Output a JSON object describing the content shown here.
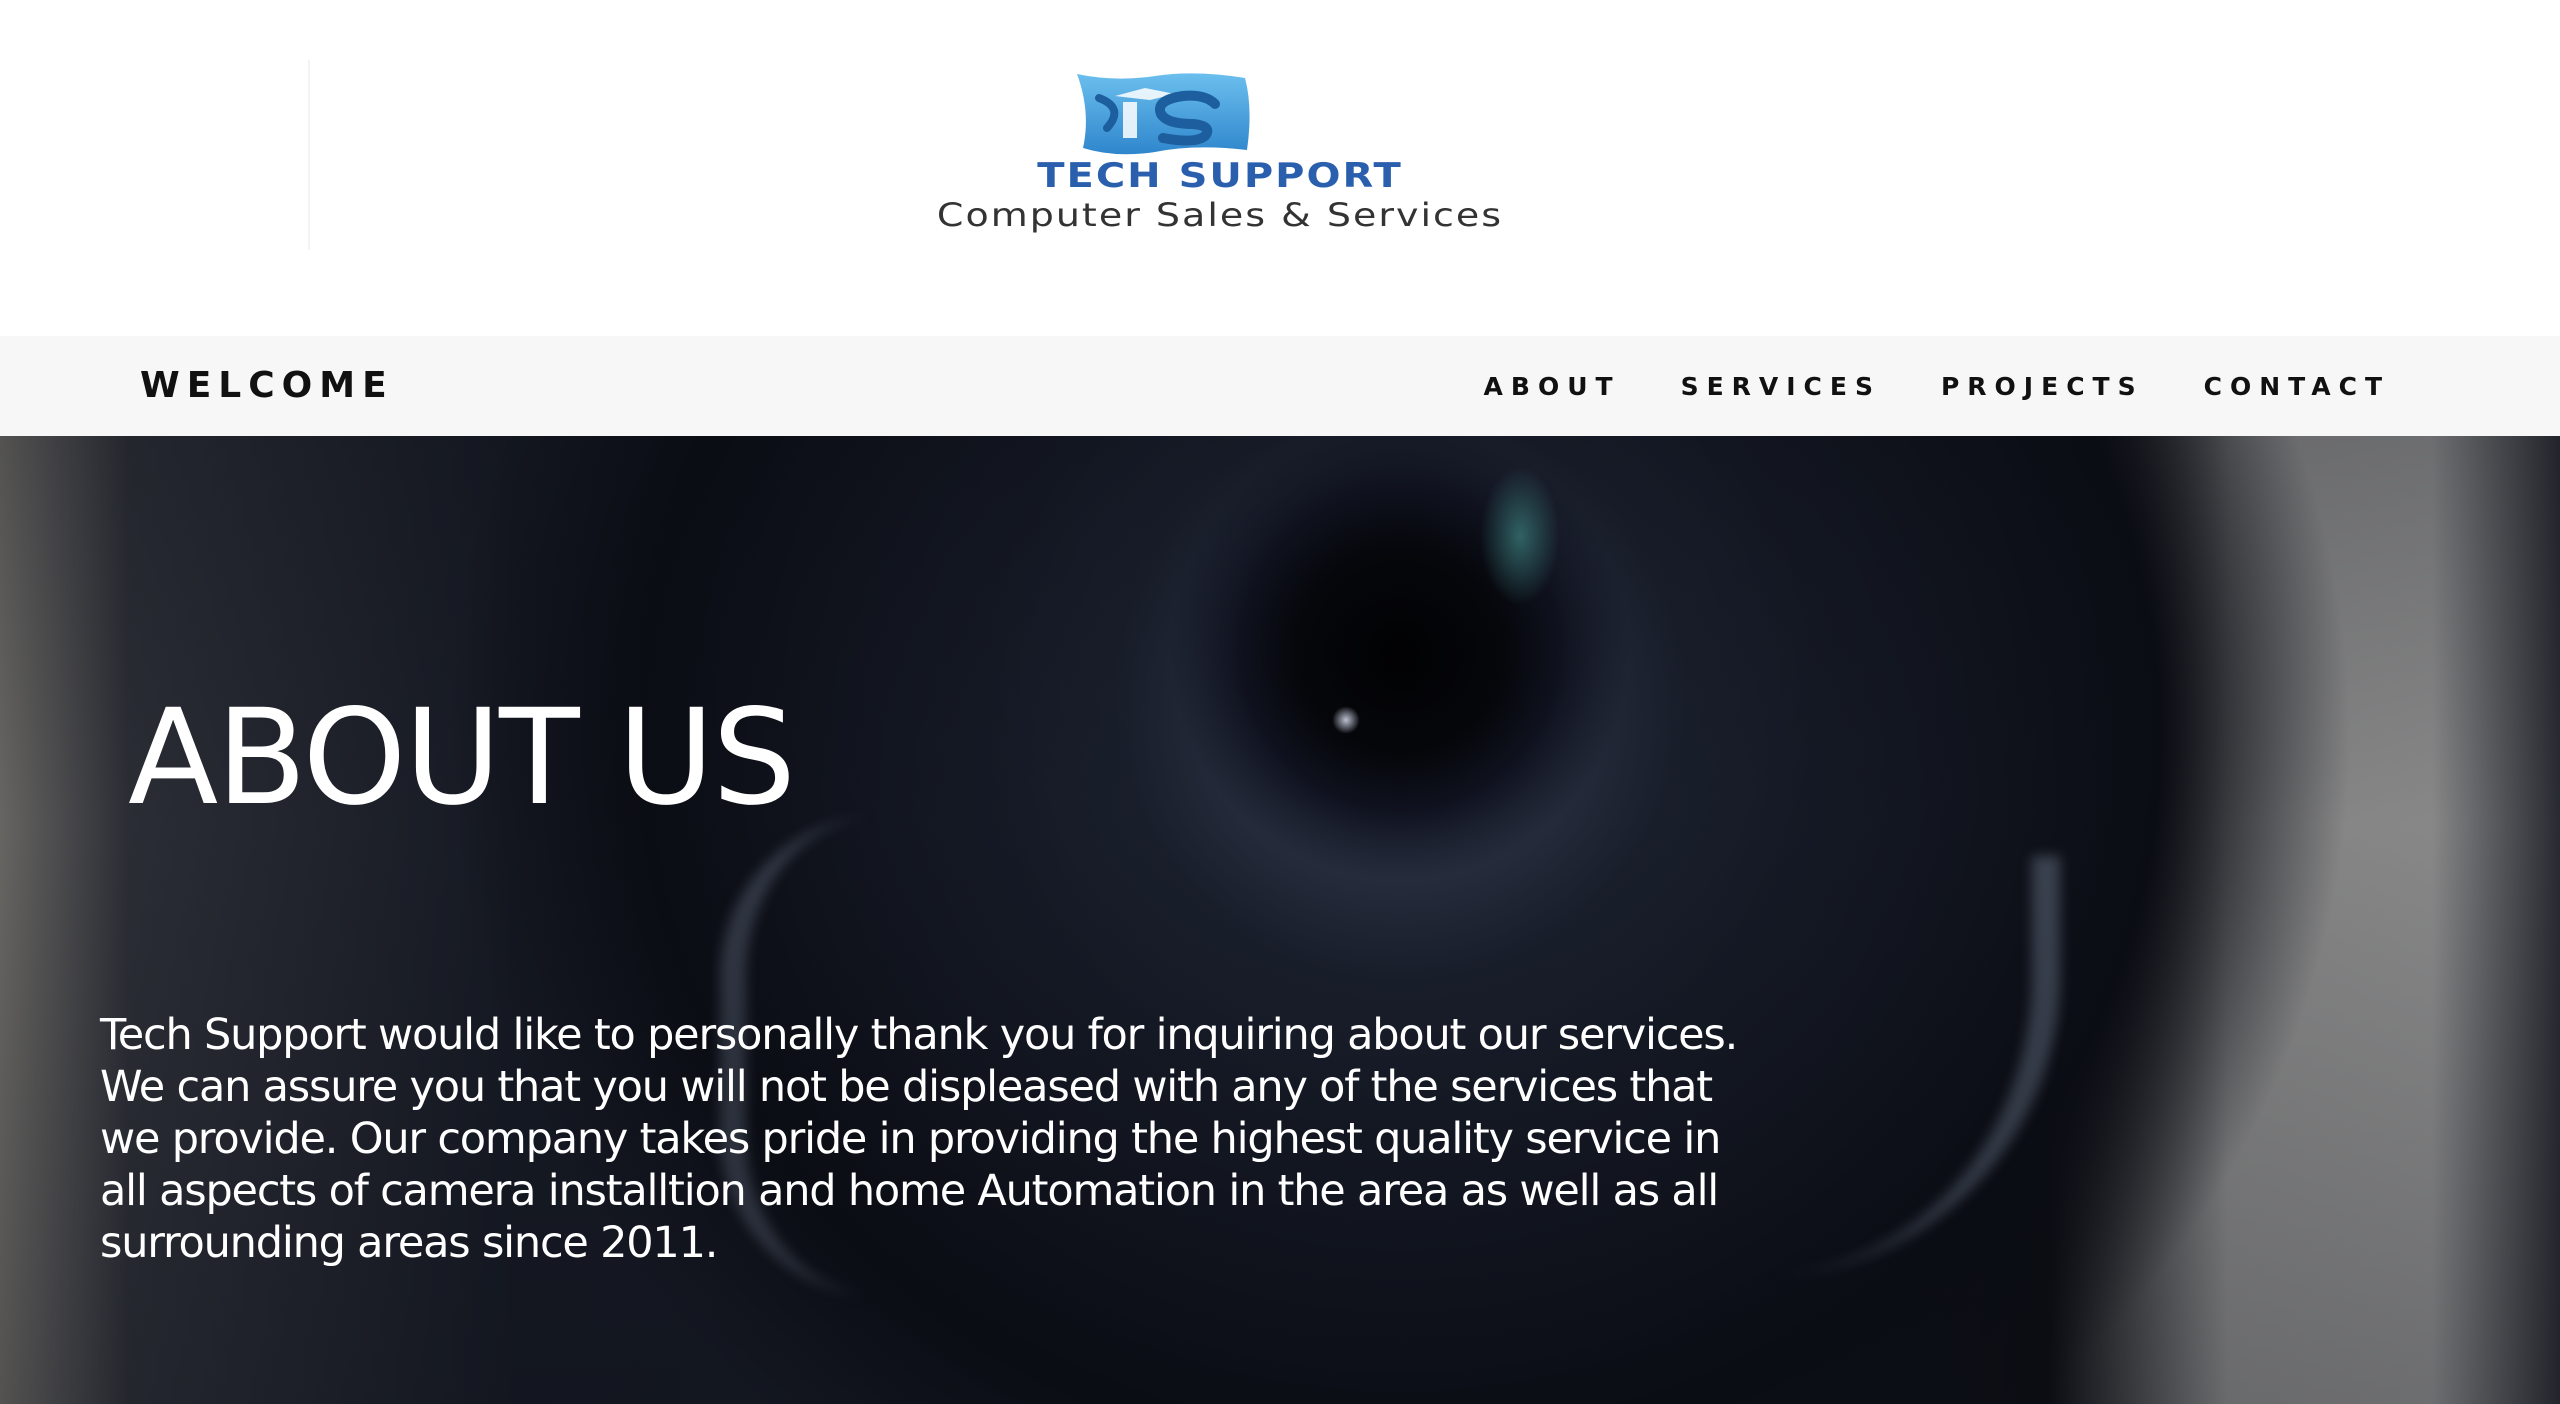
{
  "header": {
    "logo": {
      "icon": "ts-monogram-logo",
      "title": "TECH SUPPORT",
      "subtitle": "Computer Sales & Services"
    }
  },
  "nav": {
    "brand": "WELCOME",
    "links": [
      "ABOUT",
      "SERVICES",
      "PROJECTS",
      "CONTACT"
    ]
  },
  "hero": {
    "title": "ABOUT US",
    "body": "Tech Support would like to personally thank you for inquiring about our services. We can assure you that you will not be displeased with any of the services that we provide. Our company takes pride in providing the highest quality service in all aspects of camera installtion and home Automation in the area as well as all surrounding areas since 2011.",
    "background": "camera-lens-photo"
  },
  "colors": {
    "nav_bg": "#f7f7f7",
    "logo_blue": "#2a5fae",
    "logo_icon_blue": "#4aa3dc",
    "hero_text": "#ffffff"
  }
}
